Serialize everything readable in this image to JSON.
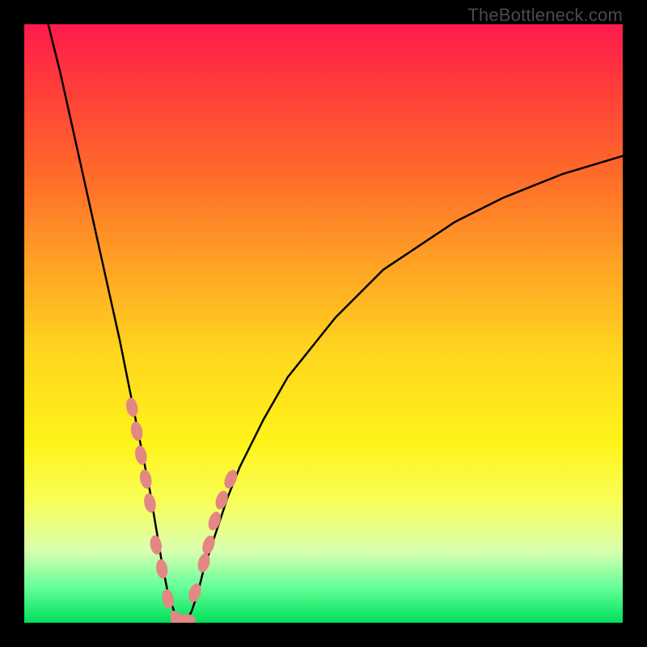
{
  "watermark": "TheBottleneck.com",
  "colors": {
    "black": "#000000",
    "marker": "#e38784",
    "gradient_top": "#ff1a4d",
    "gradient_bottom": "#00e05a"
  },
  "chart_data": {
    "type": "line",
    "title": "",
    "xlabel": "",
    "ylabel": "",
    "xlim": [
      0,
      100
    ],
    "ylim": [
      0,
      100
    ],
    "annotations": [
      "TheBottleneck.com"
    ],
    "description": "V-shaped bottleneck curve on rainbow gradient; y appears to represent bottleneck percentage (pixel height share of plot), x is an unlabeled component-performance axis. Values estimated from pixel positions.",
    "series": [
      {
        "name": "bottleneck-curve",
        "x": [
          4,
          6,
          8,
          10,
          12,
          14,
          16,
          18,
          20,
          21,
          22,
          23,
          24,
          25,
          26,
          27,
          28,
          29,
          30,
          32,
          34,
          36,
          38,
          40,
          44,
          48,
          52,
          56,
          60,
          66,
          72,
          80,
          90,
          100
        ],
        "y": [
          100,
          92,
          83,
          74,
          65,
          56,
          47,
          37,
          27,
          22,
          16,
          10,
          5,
          2,
          0,
          0,
          2,
          5,
          9,
          15,
          21,
          26,
          30,
          34,
          41,
          46,
          51,
          55,
          59,
          63,
          67,
          71,
          75,
          78
        ]
      }
    ],
    "markers": {
      "name": "highlighted-points",
      "note": "salmon lozenge markers clustered near the trough of the V",
      "x": [
        18.0,
        18.8,
        19.5,
        20.3,
        21.0,
        22.0,
        23.0,
        24.0,
        25.5,
        27.0,
        28.5,
        30.0,
        30.8,
        31.8,
        33.0,
        34.5
      ],
      "y": [
        36.0,
        32.0,
        28.0,
        24.0,
        20.0,
        13.0,
        9.0,
        4.0,
        0.5,
        0.5,
        5.0,
        10.0,
        13.0,
        17.0,
        20.5,
        24.0
      ]
    }
  }
}
